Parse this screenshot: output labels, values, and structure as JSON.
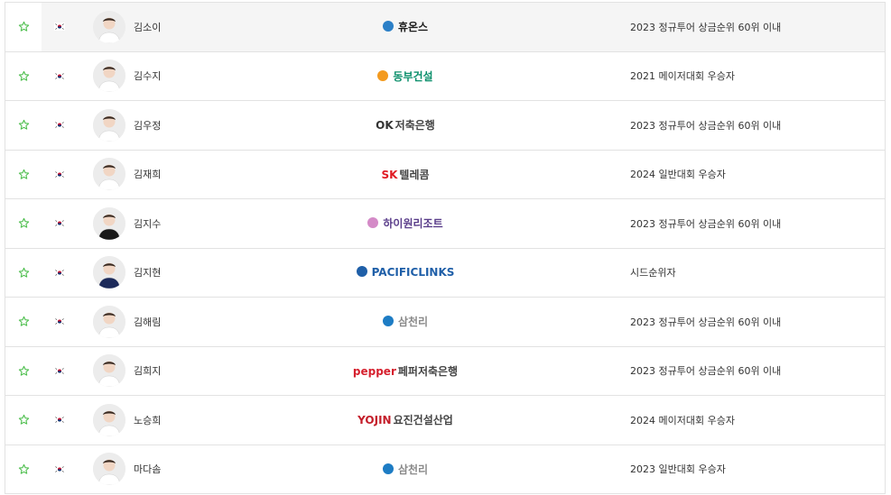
{
  "players": [
    {
      "name": "김소이",
      "sponsor": "휴온스",
      "sponsor_color": "#1a1a1a",
      "accent": "#2b7fc7",
      "qualification": "2023 정규투어 상금순위 60위 이내",
      "highlight": true,
      "shirt": "#ffffff"
    },
    {
      "name": "김수지",
      "sponsor": "동부건설",
      "sponsor_color": "#0b8f6b",
      "accent": "#f39a1f",
      "qualification": "2021 메이저대회 우승자",
      "highlight": false,
      "shirt": "#ffffff"
    },
    {
      "name": "김우정",
      "sponsor": "저축은행",
      "sponsor_prefix": "OK",
      "sponsor_color": "#333333",
      "accent": "#f2a000",
      "qualification": "2023 정규투어 상금순위 60위 이내",
      "highlight": false,
      "shirt": "#ffffff"
    },
    {
      "name": "김재희",
      "sponsor": "텔레콤",
      "sponsor_prefix": "SK",
      "sponsor_color": "#e01b24",
      "accent": "#f39a1f",
      "qualification": "2024 일반대회 우승자",
      "highlight": false,
      "shirt": "#ffffff"
    },
    {
      "name": "김지수",
      "sponsor": "하이원리조트",
      "sponsor_color": "#5a3d8a",
      "accent": "#d48ac7",
      "qualification": "2023 정규투어 상금순위 60위 이내",
      "highlight": false,
      "shirt": "#1a1a1a"
    },
    {
      "name": "김지현",
      "sponsor": "PACIFICLINKS",
      "sponsor_color": "#1f5fa8",
      "accent": "#1f5fa8",
      "qualification": "시드순위자",
      "highlight": false,
      "shirt": "#1c2a5a"
    },
    {
      "name": "김해림",
      "sponsor": "삼천리",
      "sponsor_color": "#8a8a8a",
      "accent": "#1d7cc4",
      "qualification": "2023 정규투어 상금순위 60위 이내",
      "highlight": false,
      "shirt": "#ffffff"
    },
    {
      "name": "김희지",
      "sponsor": "페퍼저축은행",
      "sponsor_prefix": "pepper",
      "sponsor_color": "#d6202e",
      "accent": "#d6202e",
      "qualification": "2023 정규투어 상금순위 60위 이내",
      "highlight": false,
      "shirt": "#ffffff"
    },
    {
      "name": "노승희",
      "sponsor": "요진건설산업",
      "sponsor_prefix": "YOJIN",
      "sponsor_color": "#c41e2a",
      "accent": "#c41e2a",
      "qualification": "2024 메이저대회 우승자",
      "highlight": false,
      "shirt": "#ffffff"
    },
    {
      "name": "마다솜",
      "sponsor": "삼천리",
      "sponsor_color": "#8a8a8a",
      "accent": "#1d7cc4",
      "qualification": "2023 일반대회 우승자",
      "highlight": false,
      "shirt": "#ffffff"
    }
  ],
  "colors": {
    "star": "#4fbf4f",
    "border": "#e2e2e2",
    "text": "#333333"
  },
  "icons": {
    "favorite": "star-outline-icon",
    "flag": "korea-flag-icon"
  }
}
